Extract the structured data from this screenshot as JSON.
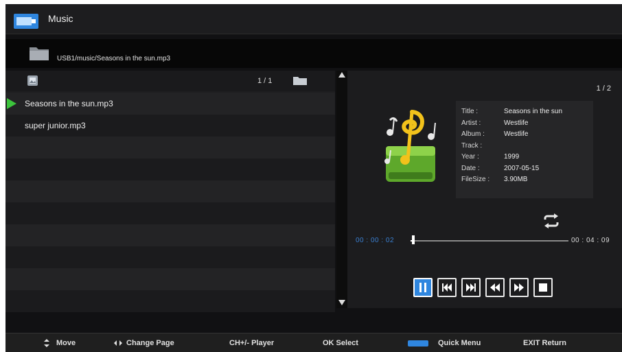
{
  "header": {
    "title": "Music",
    "icon": "music-folder-icon"
  },
  "path": {
    "text": "USB1/music/Seasons in the sun.mp3",
    "icon": "folder-icon"
  },
  "list": {
    "page": "1 / 1",
    "items": [
      {
        "name": "Seasons in the sun.mp3",
        "playing": true
      },
      {
        "name": "super junior.mp3",
        "playing": false
      }
    ]
  },
  "player": {
    "page": "1 / 2",
    "info": [
      {
        "key": "Title :",
        "value": "Seasons in the sun"
      },
      {
        "key": "Artist :",
        "value": "Westlife"
      },
      {
        "key": "Album :",
        "value": "Westlife"
      },
      {
        "key": "Track :",
        "value": ""
      },
      {
        "key": "Year :",
        "value": "1999"
      },
      {
        "key": "Date :",
        "value": "2007-05-15"
      },
      {
        "key": "FileSize :",
        "value": "3.90MB"
      }
    ],
    "time_current": "00 : 00 : 02",
    "time_total": "00 : 04 : 09",
    "progress_fraction": 0.008,
    "controls": [
      "pause",
      "previous",
      "next",
      "rewind",
      "fast-forward",
      "stop"
    ],
    "active_control": "pause"
  },
  "footer": {
    "move": "Move",
    "change_page": "Change Page",
    "player": "CH+/- Player",
    "select": "OK Select",
    "quick_menu": "Quick Menu",
    "exit": "EXIT Return"
  },
  "colors": {
    "accent": "#2f86df",
    "play_marker": "#3cc43c",
    "art_green": "#7cc43a",
    "art_gold": "#f2c21b"
  }
}
